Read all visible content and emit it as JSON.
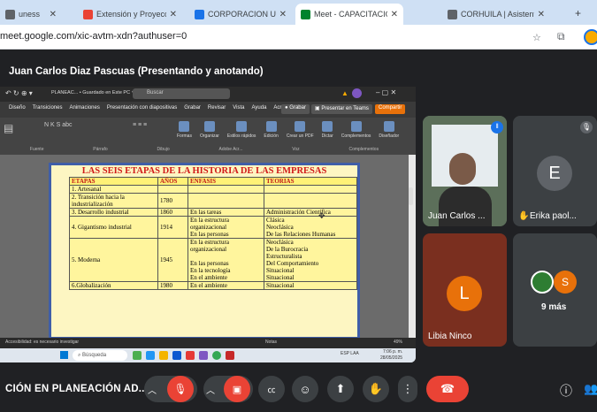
{
  "browser": {
    "tabs": [
      {
        "label": "uness",
        "icon": "generic-tab-icon",
        "color": "#5f6368"
      },
      {
        "label": "Extensión y Proyección Soci",
        "icon": "gmail-icon",
        "color": "#ea4335"
      },
      {
        "label": "CORPORACION UNIVERSITA",
        "icon": "calendar-icon",
        "color": "#1a73e8"
      },
      {
        "label": "Meet - CAPACITACIÓN E",
        "icon": "meet-icon",
        "color": "#00832d",
        "active": true
      },
      {
        "label": "CORHUILA | Asistentes",
        "icon": "globe-icon",
        "color": "#5f6368"
      }
    ],
    "url": "meet.google.com/xic-avtm-xdn?authuser=0"
  },
  "meet": {
    "presenter_label": "Juan Carlos Diaz Pascuas (Presentando y anotando)",
    "meeting_title": "CIÓN EN PLANEACIÓN AD...",
    "participants": [
      {
        "name": "Juan Carlos ...",
        "type": "video"
      },
      {
        "name": "Erika paol...",
        "initial": "E",
        "color": "#5f6368",
        "muted": true
      },
      {
        "name": "Libia Ninco",
        "initial": "L",
        "color": "#e8710a"
      },
      {
        "name": "9 más",
        "initial": "S",
        "color": "#e8710a"
      }
    ]
  },
  "powerpoint": {
    "file_title": "PLANEAC... • Guardado en Este PC ∨",
    "search": "Buscar",
    "menu": [
      "Diseño",
      "Transiciones",
      "Animaciones",
      "Presentación con diapositivas",
      "Grabar",
      "Revisar",
      "Vista",
      "Ayuda",
      "Acrobat"
    ],
    "grabar_btn": "Grabar",
    "present_btn": "Presentar en Teams",
    "share_btn": "Compartir",
    "ribbon_groups": [
      "Fuente",
      "Párrafo",
      "Dibujo",
      "Adobe Acr...",
      "Voz",
      "Complementos"
    ],
    "ribbon_buttons": [
      "Formas",
      "Organizar",
      "Estilos rápidos",
      "Edición",
      "Crear un PDF",
      "Dictar",
      "Complementos",
      "Diseñador"
    ],
    "status_left": "Accesibilidad: es necesario investigar",
    "status_right": "Notas",
    "zoom": "49%",
    "taskbar_search": "Búsqueda",
    "taskbar_lang": "ESP LAA",
    "taskbar_time": "7:06 p. m.",
    "taskbar_date": "28/05/2025"
  },
  "slide": {
    "title": "LAS SEIS ETAPAS DE LA HISTORIA DE LAS EMPRESAS",
    "headers": [
      "ETAPAS",
      "AÑOS",
      "ENFASIS",
      "TEORIAS"
    ],
    "rows": [
      {
        "etapa": "1. Artesanal",
        "anio": "",
        "enfasis": [],
        "teorias": []
      },
      {
        "etapa": "2. Transición hacia la industrialización",
        "anio": "1780",
        "enfasis": [],
        "teorias": []
      },
      {
        "etapa": "3. Desarrollo industrial",
        "anio": "1860",
        "enfasis": [
          "En las tareas"
        ],
        "teorias": [
          "Administración Científica"
        ]
      },
      {
        "etapa": "4. Gigantismo industrial",
        "anio": "1914",
        "enfasis": [
          "En la estructura organizacional",
          "En las personas"
        ],
        "teorias": [
          "Clásica",
          "Neoclásica",
          "De las Relaciones Humanas"
        ]
      },
      {
        "etapa": "5. Moderna",
        "anio": "1945",
        "enfasis": [
          "En la estructura organizacional",
          "",
          "En las personas",
          "En la tecnología",
          "En el ambiente"
        ],
        "teorias": [
          "Neoclásica",
          "De la Burocracia",
          "Estructuralista",
          "Del Comportamiento",
          "Situacional",
          "Situacional"
        ]
      },
      {
        "etapa": "6.Globalización",
        "anio": "1980",
        "enfasis": [
          "En el ambiente"
        ],
        "teorias": [
          "Situacional"
        ]
      }
    ]
  },
  "colors": {
    "end_call": "#ea4335",
    "accent": "#8ab4f8"
  }
}
